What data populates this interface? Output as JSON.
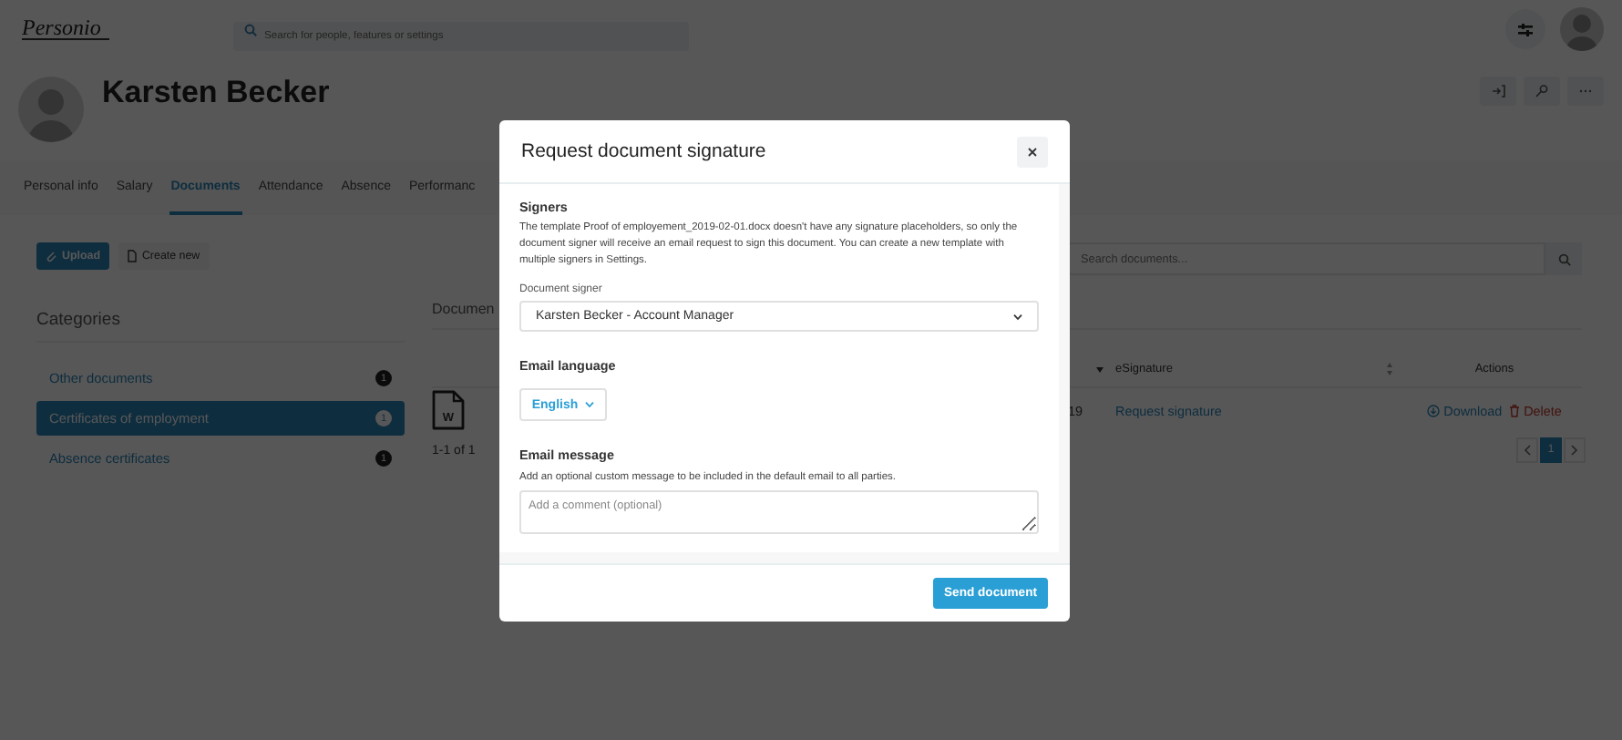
{
  "topbar": {
    "logo": "Personio",
    "search_placeholder": "Search for people, features or settings"
  },
  "profile": {
    "name": "Karsten Becker"
  },
  "tabs": [
    {
      "label": "Personal info",
      "selected": false
    },
    {
      "label": "Salary",
      "selected": false
    },
    {
      "label": "Documents",
      "selected": true
    },
    {
      "label": "Attendance",
      "selected": false
    },
    {
      "label": "Absence",
      "selected": false
    },
    {
      "label": "Performanc",
      "selected": false
    }
  ],
  "toolbar": [
    {
      "label": "Upload",
      "kind": "primary"
    },
    {
      "label": "Create new",
      "kind": "secondary"
    }
  ],
  "categories": {
    "title": "Categories",
    "items": [
      {
        "label": "Other documents",
        "count": "1",
        "selected": false
      },
      {
        "label": "Certificates of employment",
        "count": "1",
        "selected": true
      },
      {
        "label": "Absence certificates",
        "count": "1",
        "selected": false
      }
    ]
  },
  "documents": {
    "title": "Documen",
    "search_placeholder": "Search documents...",
    "columns": [
      "eSignature",
      "Actions"
    ],
    "rows": [
      {
        "file_type": "W",
        "date": "19",
        "esignature": "Request signature",
        "download": "Download",
        "delete": "Delete"
      }
    ],
    "range": "1-1 of 1",
    "pages": [
      {
        "label": "1",
        "selected": true
      }
    ]
  },
  "modal": {
    "title": "Request document signature",
    "signers_heading": "Signers",
    "signers_text": "The template Proof of employement_2019-02-01.docx doesn't have any signature placeholders, so only the document signer will receive an email request to sign this document. You can create a new template with multiple signers in Settings.",
    "signer_label": "Document signer",
    "signer_value": "Karsten Becker - Account Manager",
    "language_heading": "Email language",
    "language_value": "English",
    "message_heading": "Email message",
    "message_hint": "Add an optional custom message to be included in the default email to all parties.",
    "message_placeholder": "Add a comment (optional)",
    "submit": "Send document"
  }
}
